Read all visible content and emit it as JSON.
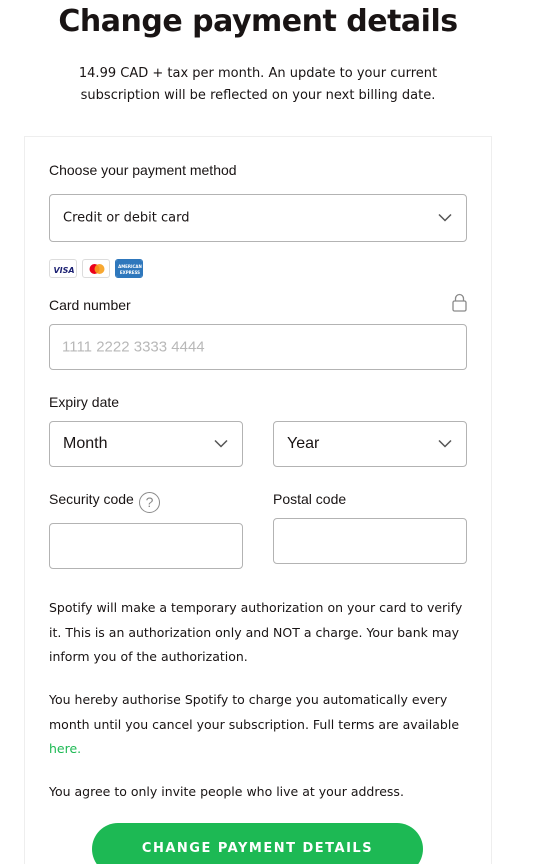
{
  "page": {
    "title": "Change payment details",
    "subtitle": "14.99 CAD + tax per month. An update to your current subscription will be reflected on your next billing date."
  },
  "payment_method": {
    "label": "Choose your payment method",
    "selected": "Credit or debit card"
  },
  "card_logos": [
    "VISA",
    "mastercard",
    "AMERICAN EXPRESS"
  ],
  "card_number": {
    "label": "Card number",
    "placeholder": "1111 2222 3333 4444",
    "icon": "lock-icon"
  },
  "expiry": {
    "label": "Expiry date",
    "month_selected": "Month",
    "year_selected": "Year"
  },
  "security_code": {
    "label": "Security code",
    "help_symbol": "?"
  },
  "postal_code": {
    "label": "Postal code"
  },
  "notices": {
    "authorization": "Spotify will make a temporary authorization on your card to verify it. This is an authorization only and NOT a charge. Your bank may inform you of the authorization.",
    "authorise": "You hereby authorise Spotify to charge you automatically every month until you cancel your subscription. Full terms are available",
    "link_text": "here.",
    "invite": "You agree to only invite people who live at your address."
  },
  "submit": {
    "label": "CHANGE PAYMENT DETAILS"
  },
  "colors": {
    "accent": "#1db954",
    "text": "#191414",
    "border": "#b3b3b3",
    "placeholder": "#b8b8b8"
  }
}
